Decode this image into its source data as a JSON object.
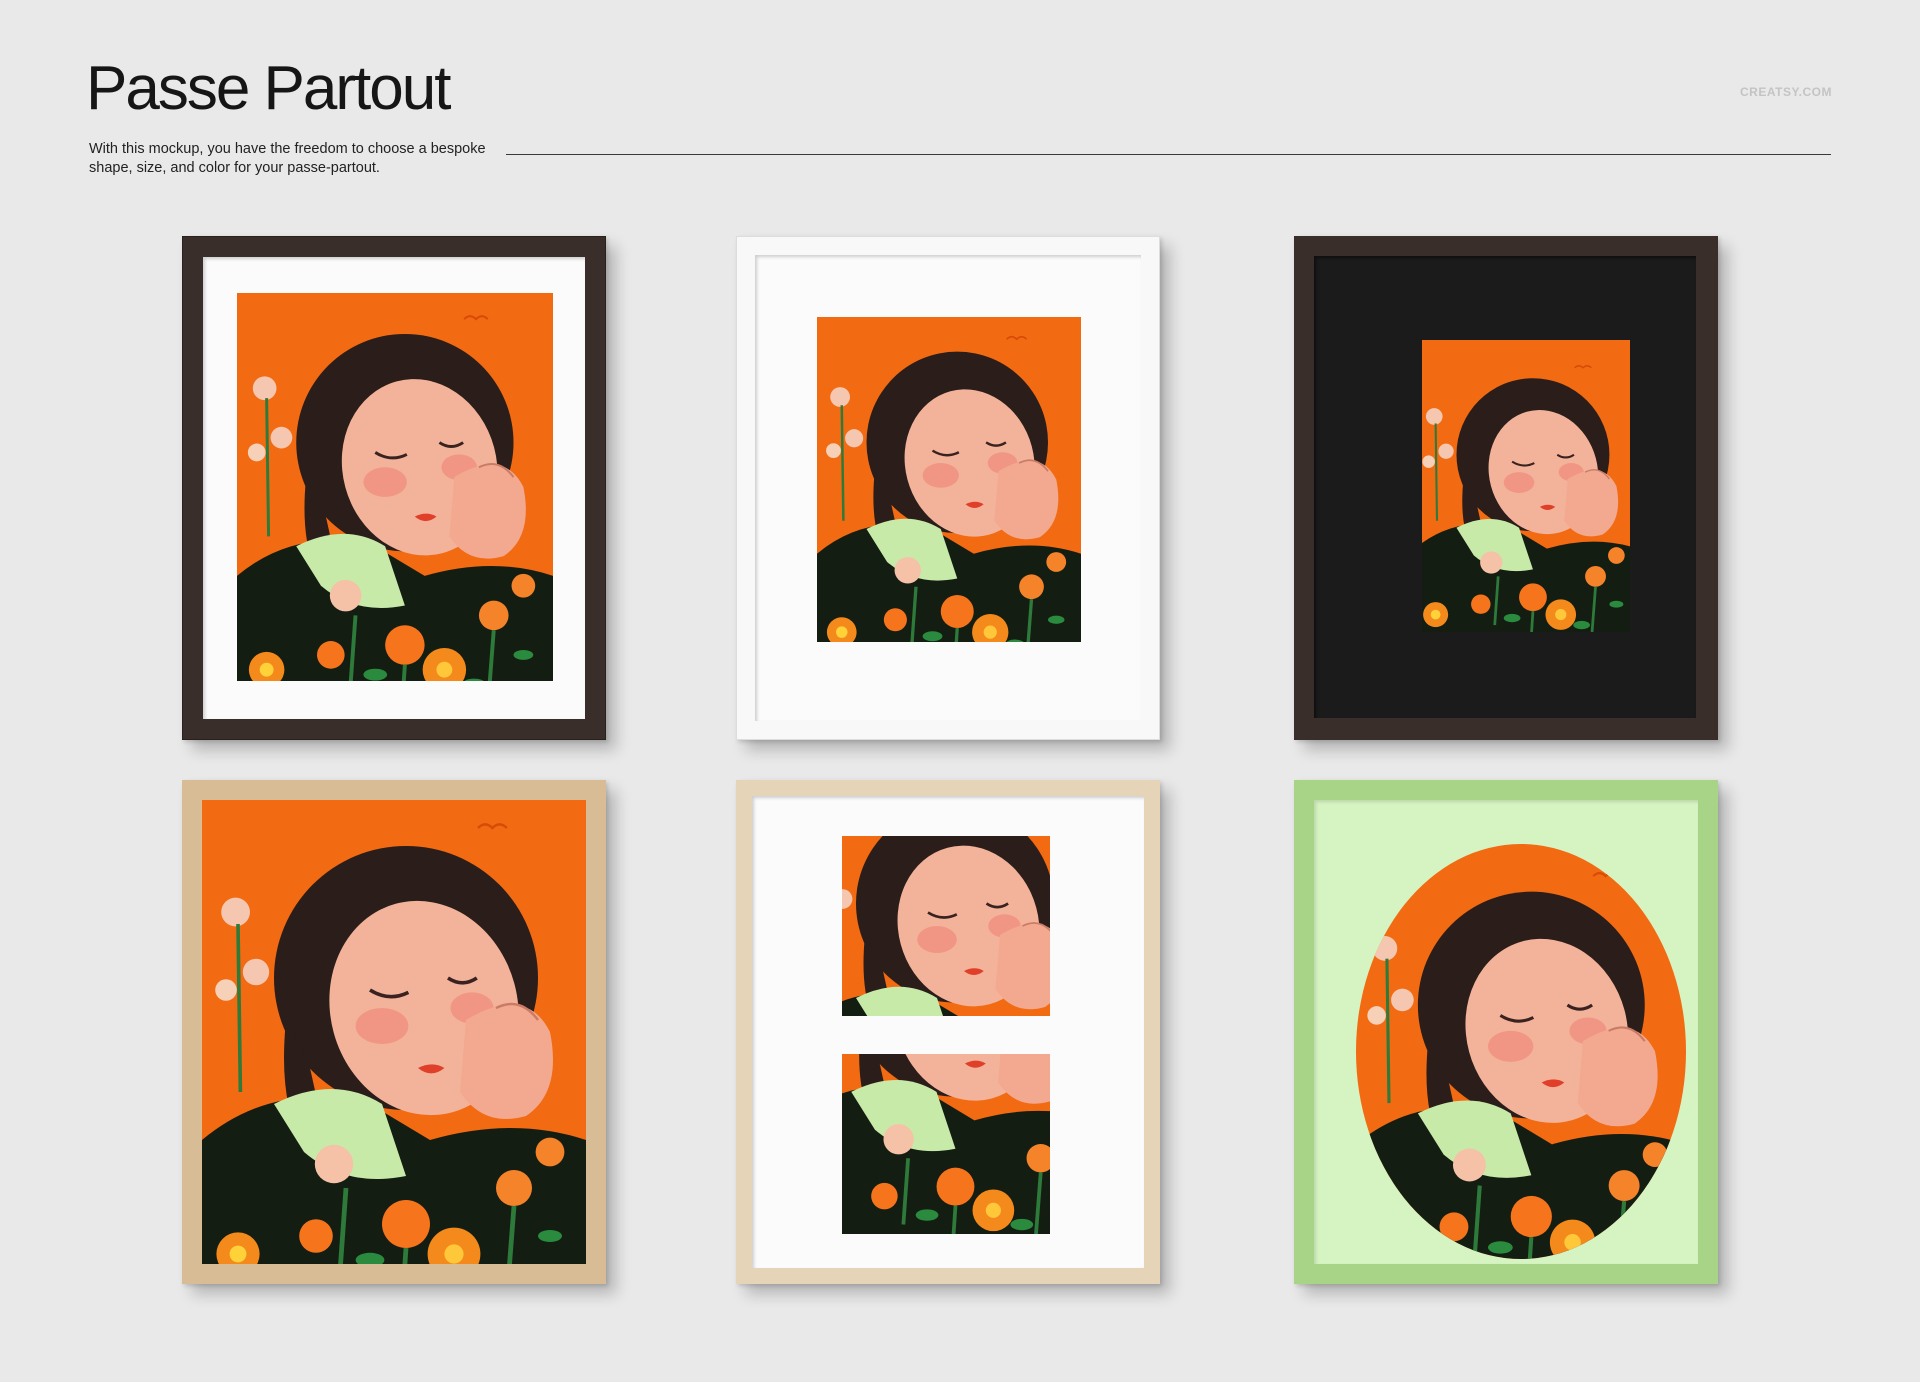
{
  "header": {
    "title": "Passe Partout",
    "subtitle": "With this mockup, you have the freedom to choose a bespoke shape, size, and color for your passe-partout.",
    "brand": "CREATSY.COM"
  },
  "colors": {
    "background": "#e9e9e9",
    "art_orange": "#f26a12",
    "frame_dark_wood": "#3a2e2a",
    "frame_white": "#f8f8f8",
    "frame_oak": "#d8bc96",
    "frame_birch": "#e5d4b7",
    "frame_green": "#a8d488",
    "mat_white": "#fbfbfb",
    "mat_black": "#1b1b1b",
    "mat_green": "#d6f3c2"
  },
  "frames": [
    {
      "name": "dark wood frame, white mat",
      "mat_shape": "rectangle"
    },
    {
      "name": "white frame, white mat",
      "mat_shape": "rectangle"
    },
    {
      "name": "dark wood frame, black mat",
      "mat_shape": "rectangle"
    },
    {
      "name": "oak frame, no mat",
      "mat_shape": "none"
    },
    {
      "name": "birch frame, white mat, two openings",
      "mat_shape": "double rectangle"
    },
    {
      "name": "green frame, light green mat",
      "mat_shape": "oval"
    }
  ],
  "artwork": {
    "icon": "sleeping-girl-with-flowers-illustration"
  }
}
